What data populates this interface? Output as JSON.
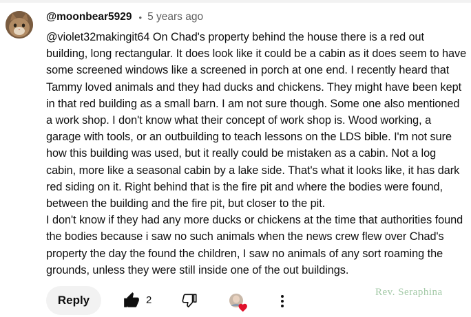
{
  "comment": {
    "author": "@moonbear5929",
    "separator": "•",
    "time": "5 years ago",
    "text": "@violet32makingit64 On Chad's property behind the house there is a red out building, long rectangular. It does look like it could be a cabin as it does seem to have some screened windows like a screened in porch at one end. I recently heard that Tammy loved animals and they had ducks and chickens. They might have been kept in that red building as a small barn. I am not sure though. Some one also mentioned a work shop. I don't know what their concept of work shop is. Wood working, a garage with tools, or an outbuilding to teach lessons on the LDS bible. I'm not sure how this building was used, but it really could be mistaken as a cabin. Not a log cabin, more like a seasonal cabin by a lake side. That's what it looks like, it has dark red siding on it. Right behind that is the fire pit and where the bodies were found, between the building and the fire pit, but closer to the pit.\nI don't know if they had any more ducks or chickens at the time that authorities found the bodies because i saw no such animals when the news crew flew over Chad's property the day the found the children, I saw no animals of any sort roaming the grounds, unless they were still inside one of the out buildings."
  },
  "actions": {
    "reply_label": "Reply",
    "like_count": "2",
    "like_icon": "thumbs-up-filled-icon",
    "dislike_icon": "thumbs-down-outline-icon",
    "hearted_icon": "creator-heart-icon",
    "more_icon": "more-vertical-icon"
  },
  "watermark": "Rev. Seraphina",
  "colors": {
    "text": "#0f0f0f",
    "secondary_text": "#606060",
    "reply_bg": "#f2f2f2",
    "heart": "#e0112b",
    "watermark": "#a3c9a7"
  }
}
